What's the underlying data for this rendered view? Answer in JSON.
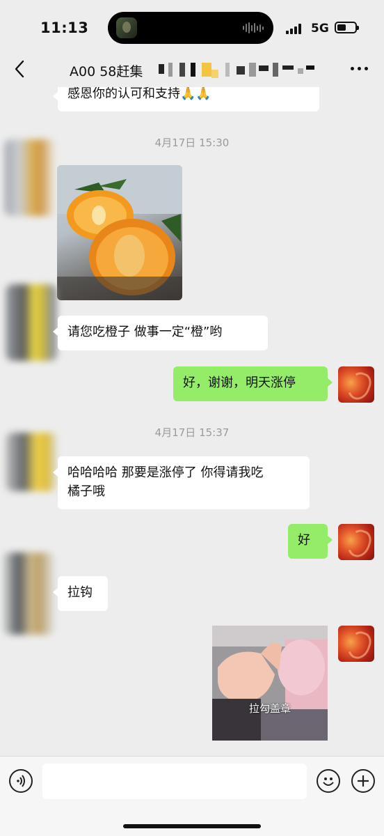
{
  "status_bar": {
    "time": "11:13",
    "network": "5G"
  },
  "nav": {
    "title": "A00 58赶集"
  },
  "messages": {
    "prev_text": "感恩你的认可和支持🙏🙏",
    "ts1": "4月17日 15:30",
    "m1_text": "请您吃橙子  做事一定“橙”哟",
    "m2_text": "好，谢谢，明天涨停",
    "ts2": "4月17日 15:37",
    "m3_line1": "哈哈哈哈  那要是涨停了 你得请我吃",
    "m3_line2": "橘子哦",
    "m4_text": "好",
    "m5_text": "拉钩",
    "sticker_text": "拉勾盖章"
  },
  "colors": {
    "background": "#ededed",
    "outgoing_bubble": "#95ec69",
    "incoming_bubble": "#ffffff"
  },
  "icons": [
    "back-icon",
    "more-icon",
    "voice-icon",
    "emoji-icon",
    "plus-icon"
  ]
}
